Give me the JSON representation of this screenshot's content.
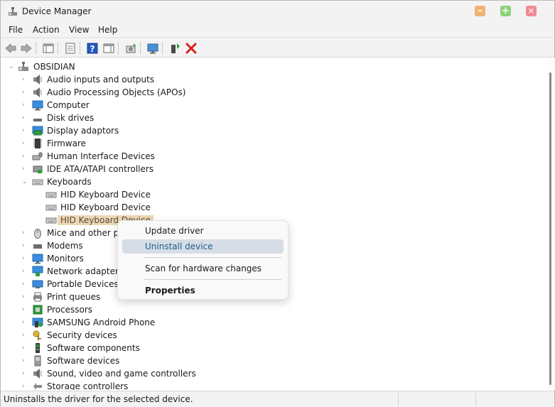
{
  "window": {
    "title": "Device Manager"
  },
  "menu": [
    "File",
    "Action",
    "View",
    "Help"
  ],
  "tree": {
    "root": "OBSIDIAN",
    "categories": [
      {
        "label": "Audio inputs and outputs",
        "icon": "speaker-icon"
      },
      {
        "label": "Audio Processing Objects (APOs)",
        "icon": "speaker-icon"
      },
      {
        "label": "Computer",
        "icon": "monitor-icon"
      },
      {
        "label": "Disk drives",
        "icon": "disk-drive-icon"
      },
      {
        "label": "Display adaptors",
        "icon": "display-adapter-icon"
      },
      {
        "label": "Firmware",
        "icon": "firmware-chip-icon"
      },
      {
        "label": "Human Interface Devices",
        "icon": "hid-icon"
      },
      {
        "label": "IDE ATA/ATAPI controllers",
        "icon": "ide-controller-icon"
      },
      {
        "label": "Keyboards",
        "icon": "keyboard-icon"
      }
    ],
    "keyboards": [
      {
        "label": "HID Keyboard Device"
      },
      {
        "label": "HID Keyboard Device"
      },
      {
        "label": "HID Keyboard Device"
      }
    ],
    "categories_after": [
      {
        "label": "Mice and other poi",
        "icon": "mouse-icon"
      },
      {
        "label": "Modems",
        "icon": "modem-icon"
      },
      {
        "label": "Monitors",
        "icon": "monitor-icon"
      },
      {
        "label": "Network adapters",
        "icon": "network-icon"
      },
      {
        "label": "Portable Devices",
        "icon": "portable-device-icon"
      },
      {
        "label": "Print queues",
        "icon": "printer-icon"
      },
      {
        "label": "Processors",
        "icon": "processor-icon"
      },
      {
        "label": "SAMSUNG Android Phone",
        "icon": "phone-icon"
      },
      {
        "label": "Security devices",
        "icon": "key-icon"
      },
      {
        "label": "Software components",
        "icon": "software-component-icon"
      },
      {
        "label": "Software devices",
        "icon": "software-device-icon"
      },
      {
        "label": "Sound, video and game controllers",
        "icon": "speaker-icon"
      },
      {
        "label": "Storage controllers",
        "icon": "storage-controller-icon"
      }
    ]
  },
  "context_menu": {
    "update_driver": "Update driver",
    "uninstall_device": "Uninstall device",
    "scan": "Scan for hardware changes",
    "properties": "Properties"
  },
  "status": {
    "text": "Uninstalls the driver for the selected device."
  },
  "colors": {
    "selected_row": "#ecd8b5",
    "menu_hover": "#d6dde6",
    "minimize": "#f0b372",
    "maximize": "#8fd27a",
    "close": "#f08a91",
    "delete_red": "#d81e1e"
  }
}
